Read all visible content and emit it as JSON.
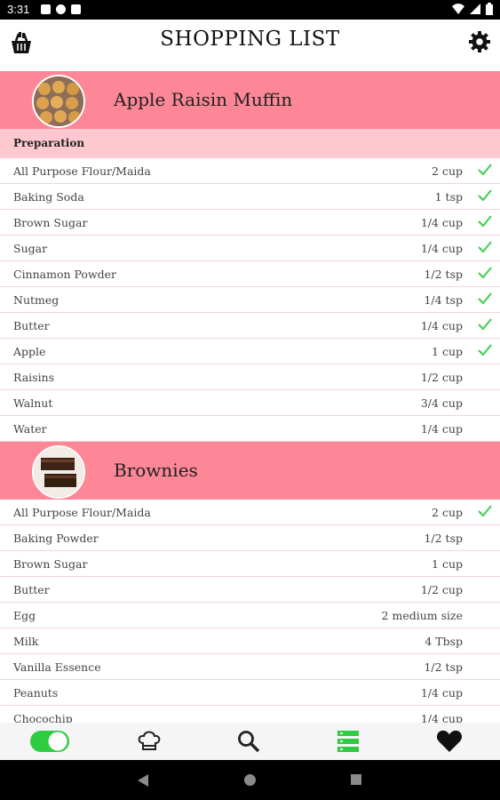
{
  "status": {
    "time": "3:31"
  },
  "header": {
    "title": "SHOPPING LIST",
    "left_icon": "basket-icon",
    "right_icon": "gear-icon"
  },
  "recipes": [
    {
      "name": "Apple Raisin Muffin",
      "section": "Preparation",
      "items": [
        {
          "name": "All Purpose Flour/Maida",
          "qty": "2 cup",
          "checked": true
        },
        {
          "name": "Baking Soda",
          "qty": "1 tsp",
          "checked": true
        },
        {
          "name": "Brown Sugar",
          "qty": "1/4 cup",
          "checked": true
        },
        {
          "name": "Sugar",
          "qty": "1/4 cup",
          "checked": true
        },
        {
          "name": "Cinnamon Powder",
          "qty": "1/2 tsp",
          "checked": true
        },
        {
          "name": "Nutmeg",
          "qty": "1/4 tsp",
          "checked": true
        },
        {
          "name": "Butter",
          "qty": "1/4 cup",
          "checked": true
        },
        {
          "name": "Apple",
          "qty": "1 cup",
          "checked": true
        },
        {
          "name": "Raisins",
          "qty": "1/2 cup",
          "checked": false
        },
        {
          "name": "Walnut",
          "qty": "3/4 cup",
          "checked": false
        },
        {
          "name": "Water",
          "qty": "1/4 cup",
          "checked": false
        }
      ]
    },
    {
      "name": "Brownies",
      "items": [
        {
          "name": "All Purpose Flour/Maida",
          "qty": "2 cup",
          "checked": true
        },
        {
          "name": "Baking Powder",
          "qty": "1/2 tsp",
          "checked": false
        },
        {
          "name": "Brown Sugar",
          "qty": "1 cup",
          "checked": false
        },
        {
          "name": "Butter",
          "qty": "1/2 cup",
          "checked": false
        },
        {
          "name": "Egg",
          "qty": "2 medium size",
          "checked": false
        },
        {
          "name": "Milk",
          "qty": "4 Tbsp",
          "checked": false
        },
        {
          "name": "Vanilla Essence",
          "qty": "1/2 tsp",
          "checked": false
        },
        {
          "name": "Peanuts",
          "qty": "1/4 cup",
          "checked": false
        },
        {
          "name": "Chocochip",
          "qty": "1/4 cup",
          "checked": false
        }
      ]
    }
  ],
  "colors": {
    "header_pink": "#fd8796",
    "section_pink": "#fdc8cf",
    "check_green": "#3ccf4e",
    "nav_green": "#2ecc40"
  },
  "bottom_nav": [
    {
      "icon": "toggle-icon",
      "active": false
    },
    {
      "icon": "chef-hat-icon",
      "active": false
    },
    {
      "icon": "search-icon",
      "active": false
    },
    {
      "icon": "list-icon",
      "active": true
    },
    {
      "icon": "heart-icon",
      "active": false
    }
  ]
}
